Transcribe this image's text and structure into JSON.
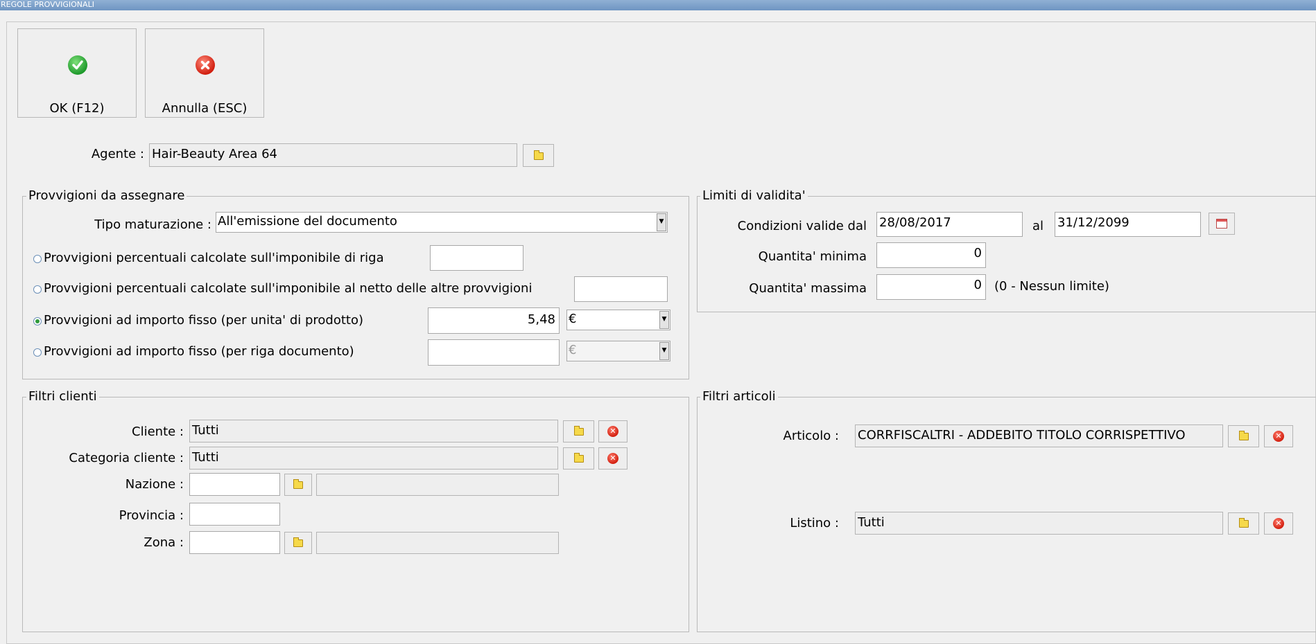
{
  "window": {
    "title": "REGOLE PROVVIGIONALI"
  },
  "toolbar": {
    "ok_label": "OK (F12)",
    "cancel_label": "Annulla (ESC)"
  },
  "agent": {
    "label": "Agente :",
    "value": "Hair-Beauty Area 64"
  },
  "provvigioni": {
    "legend": "Provvigioni da assegnare",
    "tipo_label": "Tipo maturazione :",
    "tipo_value": "All'emissione del documento",
    "options": [
      {
        "label": "Provvigioni percentuali calcolate sull'imponibile di riga",
        "value": "",
        "selected": false
      },
      {
        "label": "Provvigioni percentuali calcolate sull'imponibile al netto delle altre provvigioni",
        "value": "",
        "selected": false
      },
      {
        "label": "Provvigioni ad importo fisso (per unita' di prodotto)",
        "value": "5,48",
        "currency": "€",
        "selected": true
      },
      {
        "label": "Provvigioni ad importo fisso (per riga documento)",
        "value": "",
        "currency": "€",
        "selected": false
      }
    ]
  },
  "limiti": {
    "legend": "Limiti di validita'",
    "valid_from_label": "Condizioni valide dal",
    "valid_from": "28/08/2017",
    "to_label": "al",
    "valid_to": "31/12/2099",
    "qty_min_label": "Quantita' minima",
    "qty_min": "0",
    "qty_max_label": "Quantita' massima",
    "qty_max": "0",
    "qty_max_note": "(0 - Nessun limite)"
  },
  "filtri_clienti": {
    "legend": "Filtri clienti",
    "cliente_label": "Cliente :",
    "cliente_value": "Tutti",
    "categoria_label": "Categoria cliente :",
    "categoria_value": "Tutti",
    "nazione_label": "Nazione :",
    "nazione_code": "",
    "nazione_desc": "",
    "provincia_label": "Provincia :",
    "provincia_value": "",
    "zona_label": "Zona :",
    "zona_code": "",
    "zona_desc": ""
  },
  "filtri_articoli": {
    "legend": "Filtri articoli",
    "articolo_label": "Articolo :",
    "articolo_value": "CORRFISCALTRI - ADDEBITO TITOLO CORRISPETTIVO",
    "listino_label": "Listino :",
    "listino_value": "Tutti"
  },
  "icons": {
    "ok": "check-icon",
    "cancel": "cancel-icon",
    "browse": "folder-icon",
    "clear": "clear-icon",
    "calendar": "calendar-icon"
  },
  "colors": {
    "titlebar": "#7a9cc6",
    "ok_green": "#2eaa3c",
    "cancel_red": "#d9271a",
    "radio_selected": "#2f9a3a"
  }
}
